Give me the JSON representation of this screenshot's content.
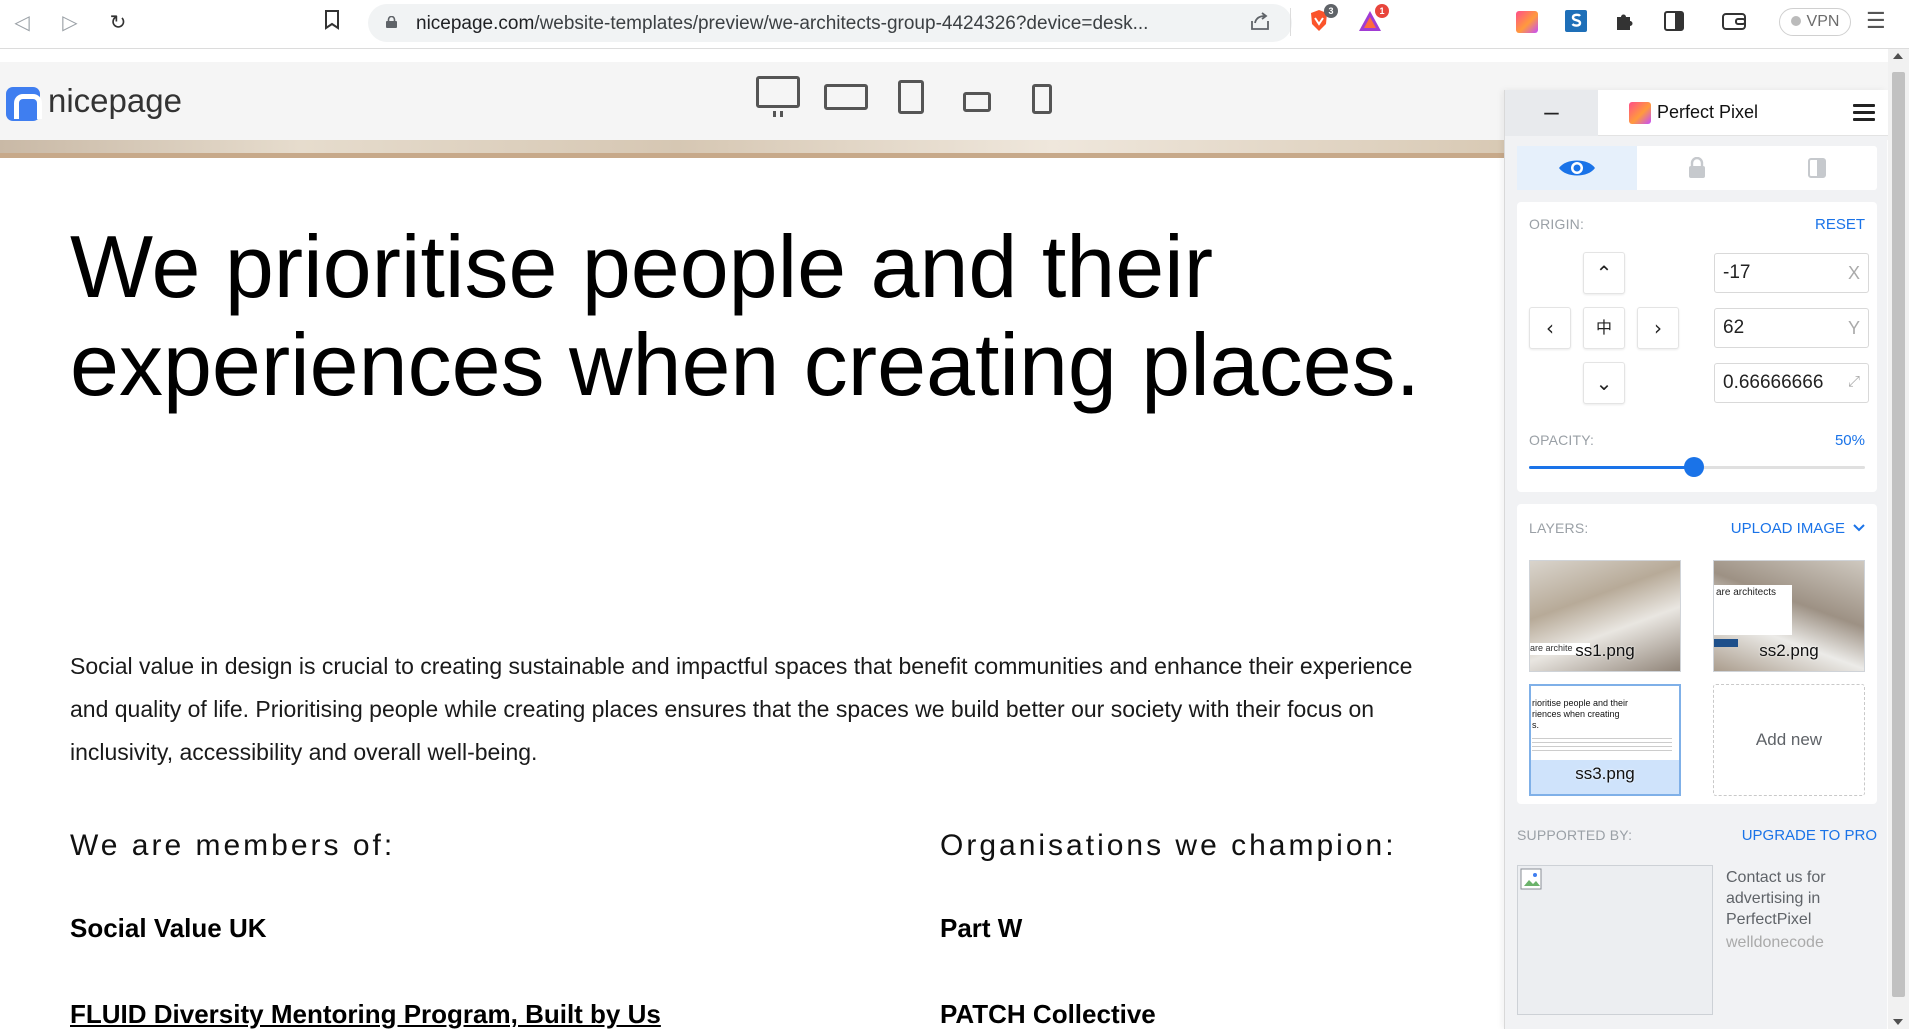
{
  "browser": {
    "url_host": "nicepage.com",
    "url_path": "/website-templates/preview/we-architects-group-4424326?device=desk...",
    "brave_badge": "3",
    "alert_badge": "1",
    "vpn_label": "VPN"
  },
  "site": {
    "logo_text": "nicepage",
    "headline": "We prioritise people and their experiences when creating places.",
    "body": "Social value in design is crucial to creating sustainable and impactful spaces that benefit communities and enhance their experience and quality of life. Prioritising people while creating places ensures that the spaces we build better our society with their focus on inclusivity, accessibility and overall well-being.",
    "col_left_heading": "We are members of:",
    "col_right_heading": "Organisations we champion:",
    "left_orgs": [
      "Social Value UK",
      "FLUID Diversity Mentoring Program, Built by Us"
    ],
    "right_orgs": [
      "Part W",
      "PATCH Collective"
    ]
  },
  "perfect_pixel": {
    "minimize_label": "–",
    "title": "Perfect Pixel",
    "origin_label": "ORIGIN:",
    "reset_label": "RESET",
    "x_value": "-17",
    "y_value": "62",
    "scale_value": "0.66666666",
    "x_axis": "X",
    "y_axis": "Y",
    "opacity_label": "OPACITY:",
    "opacity_value": "50%",
    "opacity_fraction": 0.49,
    "layers_label": "LAYERS:",
    "upload_label": "UPLOAD IMAGE",
    "layers": [
      {
        "name": "ss1.png",
        "thumb_text": "are archite"
      },
      {
        "name": "ss2.png",
        "thumb_text": "are architects"
      },
      {
        "name": "ss3.png",
        "thumb_text": "rioritise people and their\nriences when creating\ns."
      }
    ],
    "add_new_label": "Add new",
    "supported_label": "SUPPORTED BY:",
    "upgrade_label": "UPGRADE TO PRO",
    "ad_text": "Contact us for advertising in PerfectPixel",
    "ad_credit": "welldonecode"
  },
  "colors": {
    "accent": "#1a73e8",
    "nicepage_blue": "#3f7ef0"
  }
}
